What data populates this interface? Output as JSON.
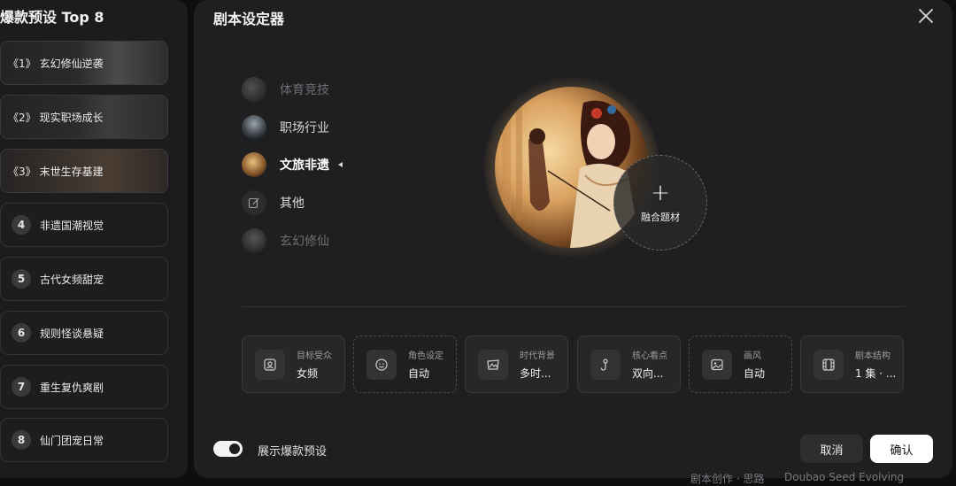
{
  "left_panel": {
    "title": "爆款预设 Top 8",
    "items": [
      {
        "num": "《1》",
        "label": "玄幻修仙逆袭",
        "bracketed": true
      },
      {
        "num": "《2》",
        "label": "现实职场成长",
        "bracketed": true
      },
      {
        "num": "《3》",
        "label": "末世生存基建",
        "bracketed": true
      },
      {
        "num": "4",
        "label": "非遗国潮视觉",
        "bracketed": false
      },
      {
        "num": "5",
        "label": "古代女频甜宠",
        "bracketed": false
      },
      {
        "num": "6",
        "label": "规则怪谈悬疑",
        "bracketed": false
      },
      {
        "num": "7",
        "label": "重生复仇爽剧",
        "bracketed": false
      },
      {
        "num": "8",
        "label": "仙门团宠日常",
        "bracketed": false
      }
    ]
  },
  "dialog": {
    "title": "剧本设定器",
    "categories": [
      {
        "label": "体育竞技",
        "state": "dim"
      },
      {
        "label": "职场行业",
        "state": "normal"
      },
      {
        "label": "文旅非遗",
        "state": "active"
      },
      {
        "label": "其他",
        "state": "normal"
      },
      {
        "label": "玄幻修仙",
        "state": "dim"
      }
    ],
    "fuse_label": "融合题材",
    "fuse_plus": "+",
    "settings": [
      {
        "label": "目标受众",
        "value": "女频",
        "icon": "audience-icon",
        "dashed": false
      },
      {
        "label": "角色设定",
        "value": "自动",
        "icon": "smile-face-icon",
        "dashed": true
      },
      {
        "label": "时代背景",
        "value": "多时...",
        "icon": "landscape-icon",
        "dashed": false
      },
      {
        "label": "核心看点",
        "value": "双向...",
        "icon": "hook-icon",
        "dashed": false
      },
      {
        "label": "画风",
        "value": "自动",
        "icon": "picture-icon",
        "dashed": true
      },
      {
        "label": "剧本结构",
        "value": "1 集 · ...",
        "icon": "film-icon",
        "dashed": false
      }
    ],
    "toggle_label": "展示爆款预设",
    "toggle_on": true,
    "cancel_label": "取消",
    "confirm_label": "确认"
  },
  "background_text": {
    "left": "剧本创作 · 思路",
    "right": "Doubao Seed Evolving"
  }
}
